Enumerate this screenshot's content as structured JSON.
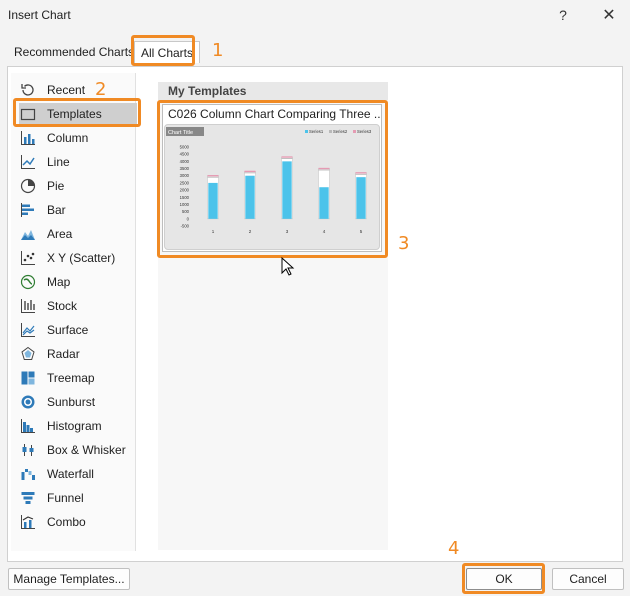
{
  "window": {
    "title": "Insert Chart",
    "help_label": "?",
    "close_label": "✕"
  },
  "tabs": [
    {
      "label": "Recommended Charts"
    },
    {
      "label": "All Charts"
    }
  ],
  "annotations": [
    "1",
    "2",
    "3",
    "4"
  ],
  "sidebar": {
    "items": [
      {
        "label": "Recent",
        "icon": "recent-icon"
      },
      {
        "label": "Templates",
        "icon": "folder-icon"
      },
      {
        "label": "Column",
        "icon": "column-chart-icon"
      },
      {
        "label": "Line",
        "icon": "line-chart-icon"
      },
      {
        "label": "Pie",
        "icon": "pie-chart-icon"
      },
      {
        "label": "Bar",
        "icon": "bar-chart-icon"
      },
      {
        "label": "Area",
        "icon": "area-chart-icon"
      },
      {
        "label": "X Y (Scatter)",
        "icon": "scatter-chart-icon"
      },
      {
        "label": "Map",
        "icon": "map-chart-icon"
      },
      {
        "label": "Stock",
        "icon": "stock-chart-icon"
      },
      {
        "label": "Surface",
        "icon": "surface-chart-icon"
      },
      {
        "label": "Radar",
        "icon": "radar-chart-icon"
      },
      {
        "label": "Treemap",
        "icon": "treemap-chart-icon"
      },
      {
        "label": "Sunburst",
        "icon": "sunburst-chart-icon"
      },
      {
        "label": "Histogram",
        "icon": "histogram-chart-icon"
      },
      {
        "label": "Box & Whisker",
        "icon": "box-whisker-chart-icon"
      },
      {
        "label": "Waterfall",
        "icon": "waterfall-chart-icon"
      },
      {
        "label": "Funnel",
        "icon": "funnel-chart-icon"
      },
      {
        "label": "Combo",
        "icon": "combo-chart-icon"
      }
    ]
  },
  "main": {
    "section_title": "My Templates",
    "template_name": "C026 Column Chart Comparing Three ..."
  },
  "thumbnail": {
    "chart_title": "Chart Title",
    "legend": [
      "Series1",
      "Series2",
      "Series3"
    ],
    "y_ticks": [
      "5000",
      "4500",
      "4000",
      "3500",
      "3000",
      "2500",
      "2000",
      "1500",
      "1000",
      "500",
      "0",
      "-500"
    ],
    "x_ticks": [
      "1",
      "2",
      "3",
      "4",
      "5"
    ]
  },
  "buttons": {
    "manage": "Manage Templates...",
    "ok": "OK",
    "cancel": "Cancel"
  },
  "colors": {
    "accent_orange": "#f08a24",
    "bar_blue": "#4cc3ea",
    "bar_pink": "#e59bb3"
  },
  "chart_data": {
    "type": "bar",
    "title": "Chart Title",
    "categories": [
      "1",
      "2",
      "3",
      "4",
      "5"
    ],
    "series": [
      {
        "name": "Series1",
        "values": [
          2500,
          3000,
          4000,
          2200,
          2900
        ]
      },
      {
        "name": "Series2",
        "values": [
          2900,
          3200,
          4200,
          3400,
          3100
        ]
      },
      {
        "name": "Series3",
        "values": [
          3000,
          3300,
          4300,
          3500,
          3200
        ]
      }
    ],
    "ylim": [
      -500,
      5000
    ],
    "legend": "top-right",
    "grid": false
  }
}
